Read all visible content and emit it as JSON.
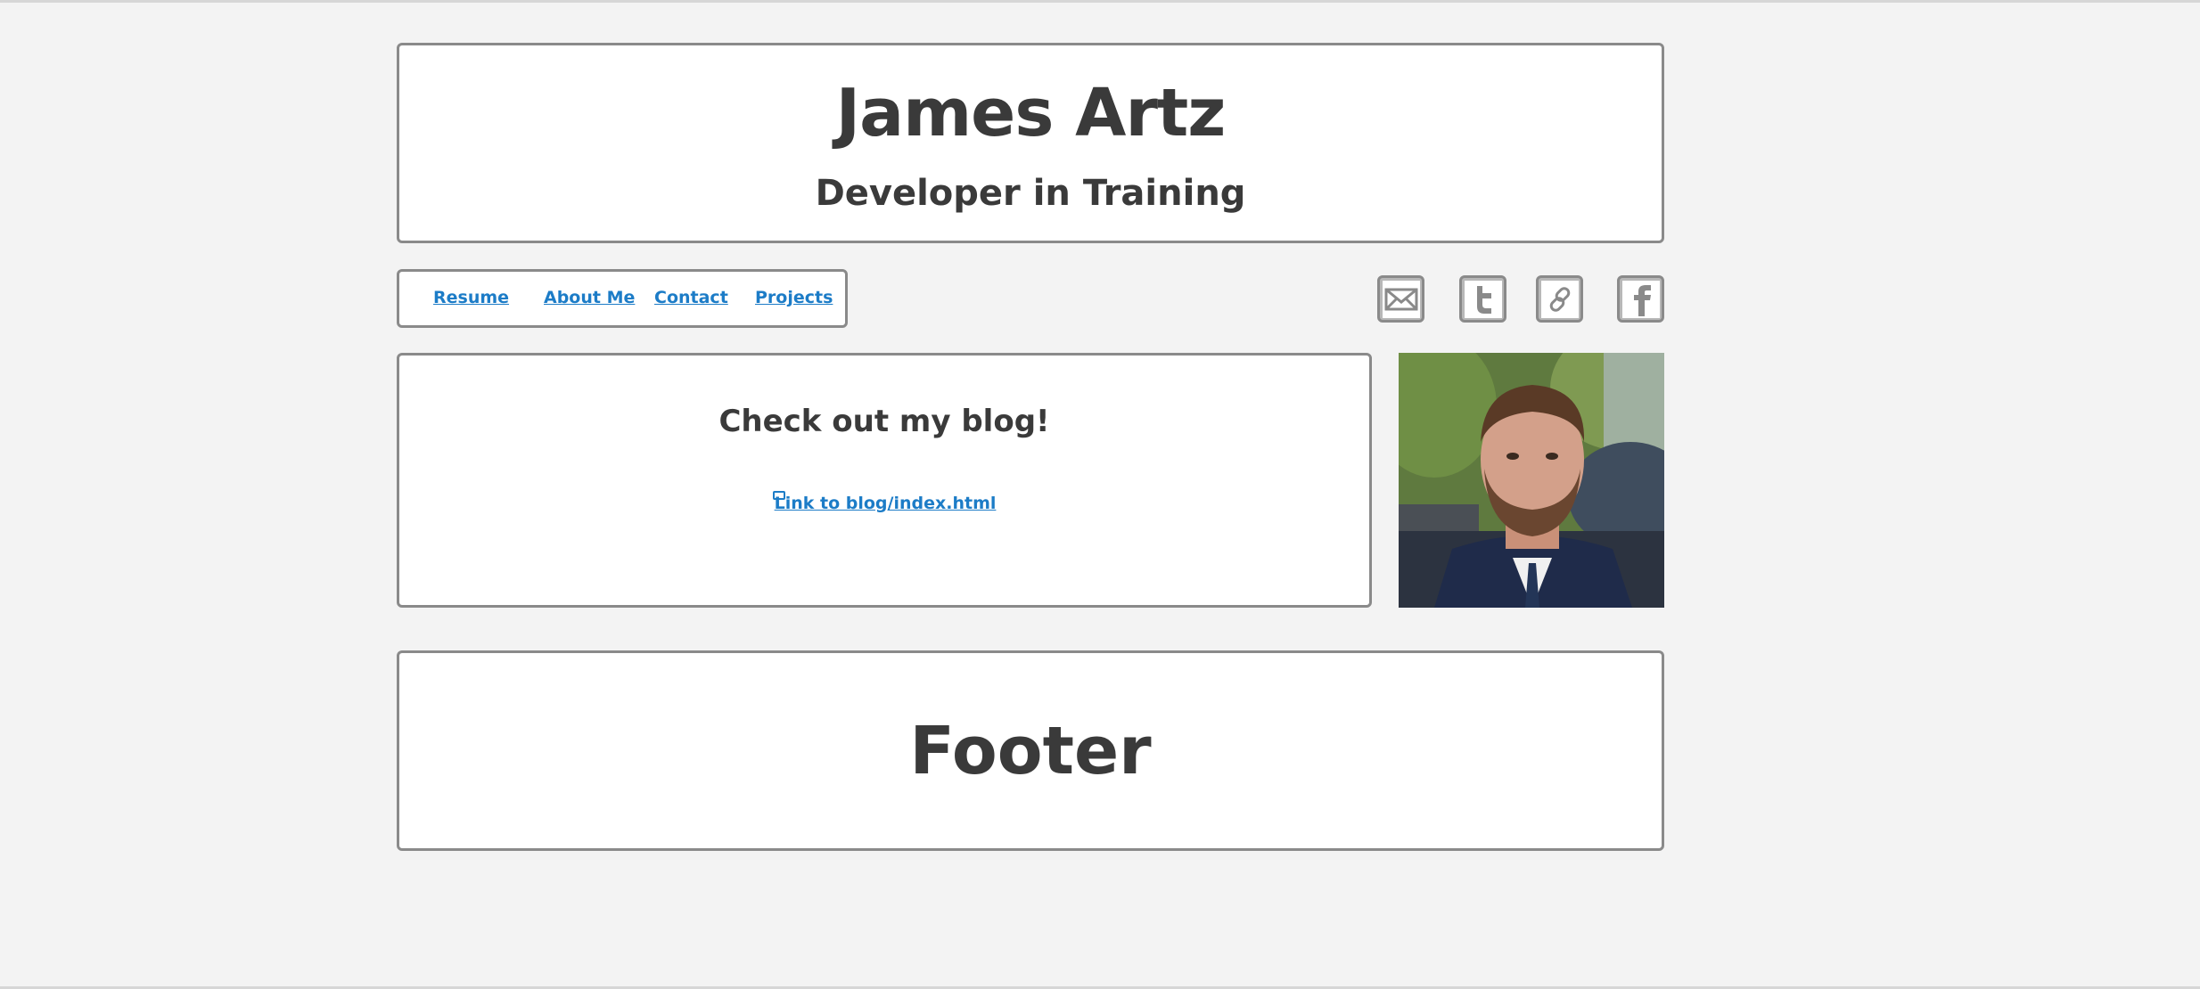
{
  "header": {
    "title": "James Artz",
    "subtitle": "Developer in Training"
  },
  "nav": {
    "items": [
      {
        "label": "Resume"
      },
      {
        "label": "About Me"
      },
      {
        "label": "Contact"
      },
      {
        "label": "Projects"
      }
    ]
  },
  "social": {
    "icons": [
      "envelope-icon",
      "twitter-icon",
      "link-icon",
      "facebook-icon"
    ],
    "icon_color": "#8a8a8a",
    "icon_bg": "#b8b8b8"
  },
  "main": {
    "heading": "Check out my blog!",
    "blog_link": "Link to blog/index.html"
  },
  "profile": {
    "image": "profile-photo"
  },
  "footer": {
    "text": "Footer"
  },
  "colors": {
    "link": "#1c7cc7",
    "text": "#3a3a3a",
    "border": "#8a8a8a",
    "background": "#f3f3f3"
  }
}
